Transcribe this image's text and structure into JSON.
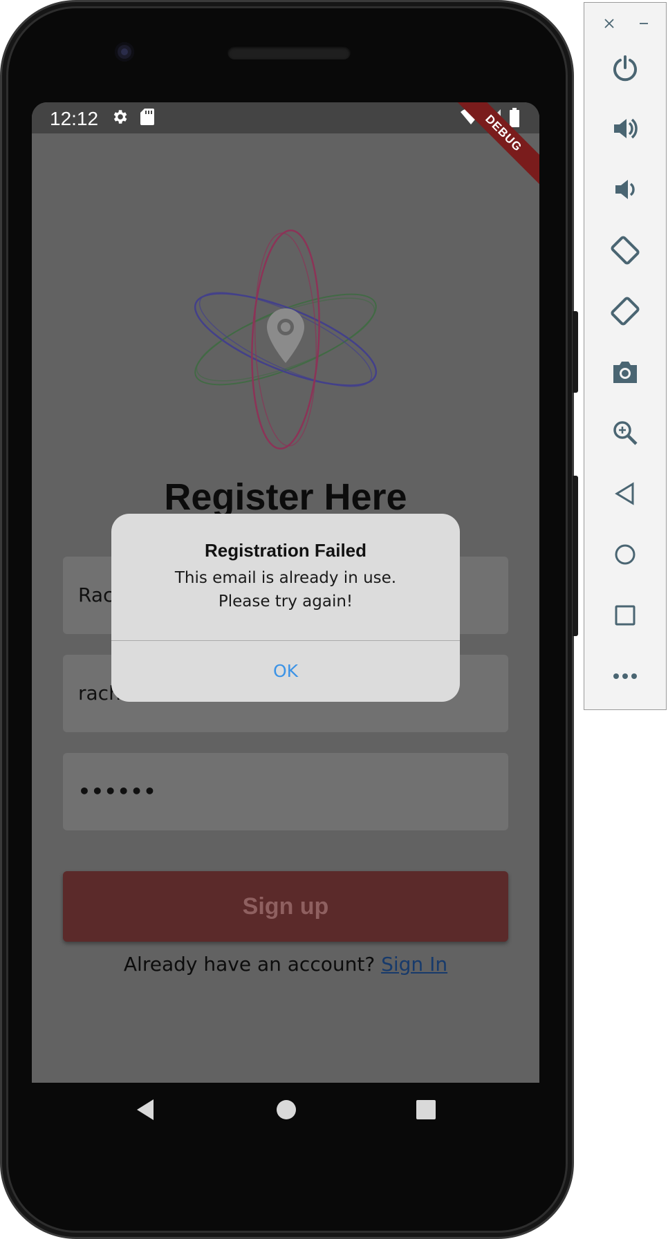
{
  "status_bar": {
    "time": "12:12",
    "debug_banner": "DEBUG"
  },
  "register": {
    "title": "Register Here",
    "name_value": "Rac",
    "email_value": "rach",
    "password_value": "••••••",
    "signup_label": "Sign up",
    "account_prompt": "Already have an account?",
    "signin_link": "Sign In"
  },
  "dialog": {
    "title": "Registration Failed",
    "message_line1": "This email is already in use.",
    "message_line2": "Please try again!",
    "ok_label": "OK"
  },
  "emulator_toolbar": {
    "icons": [
      "close-icon",
      "minimize-icon",
      "power-icon",
      "volume-up-icon",
      "volume-down-icon",
      "rotate-left-icon",
      "rotate-right-icon",
      "camera-icon",
      "zoom-icon",
      "back-icon",
      "home-icon",
      "overview-icon",
      "more-icon"
    ]
  },
  "colors": {
    "accent_link": "#173a6b",
    "dialog_button": "#3c93e6",
    "signup_button": "#5b2a2a",
    "debug_banner": "#7a1c1c"
  }
}
